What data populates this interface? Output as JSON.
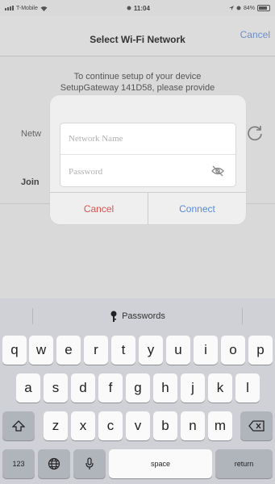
{
  "status": {
    "carrier": "T-Mobile",
    "time": "11:04",
    "battery": "84%"
  },
  "nav": {
    "title": "Select Wi-Fi Network",
    "cancel": "Cancel"
  },
  "instructions": {
    "line1": "To continue setup of your device",
    "line2": "SetupGateway 141D58, please provide"
  },
  "background_labels": {
    "network": "Netw",
    "join": "Join "
  },
  "alert": {
    "network_placeholder": "Network Name",
    "password_placeholder": "Password",
    "cancel": "Cancel",
    "connect": "Connect"
  },
  "keyboard": {
    "suggestion": "Passwords",
    "row1": [
      "q",
      "w",
      "e",
      "r",
      "t",
      "y",
      "u",
      "i",
      "o",
      "p"
    ],
    "row2": [
      "a",
      "s",
      "d",
      "f",
      "g",
      "h",
      "j",
      "k",
      "l"
    ],
    "row3": [
      "z",
      "x",
      "c",
      "v",
      "b",
      "n",
      "m"
    ],
    "numbers_key": "123",
    "space_key": "space",
    "return_key": "return"
  },
  "colors": {
    "accent": "#5a8bd6",
    "destructive": "#d9534f"
  }
}
